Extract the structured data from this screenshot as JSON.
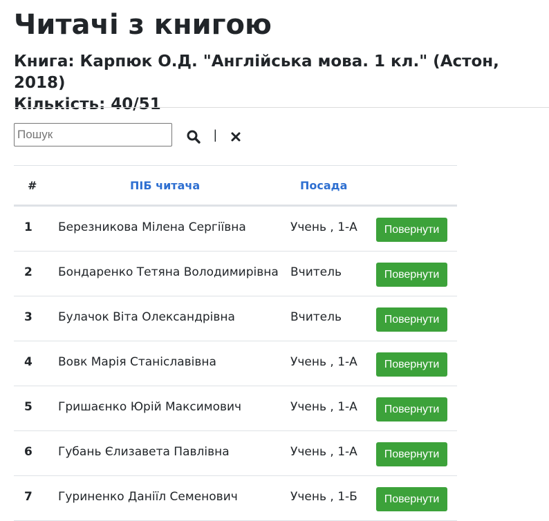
{
  "page": {
    "title": "Читачі з книгою",
    "book_line": "Книга: Карпюк О.Д. \"Англійська мова. 1 кл.\" (Астон, 2018)",
    "count_line": "Кількість: 40/51"
  },
  "search": {
    "placeholder": "Пошук",
    "value": "",
    "separator": "|",
    "search_icon": "search-icon",
    "clear_icon": "close-icon"
  },
  "table": {
    "headers": {
      "num": "#",
      "name": "ПІБ читача",
      "position": "Посада"
    },
    "rows": [
      {
        "num": "1",
        "name": "Березникова Мілена Сергіївна",
        "position": "Учень , 1-А",
        "action": "Повернути"
      },
      {
        "num": "2",
        "name": "Бондаренко Тетяна Володимирівна",
        "position": "Вчитель",
        "action": "Повернути"
      },
      {
        "num": "3",
        "name": "Булачок Віта Олександрівна",
        "position": "Вчитель",
        "action": "Повернути"
      },
      {
        "num": "4",
        "name": "Вовк Марія Станіславівна",
        "position": "Учень , 1-А",
        "action": "Повернути"
      },
      {
        "num": "5",
        "name": "Гришаєнко Юрій Максимович",
        "position": "Учень , 1-А",
        "action": "Повернути"
      },
      {
        "num": "6",
        "name": "Губань Єлизавета Павлівна",
        "position": "Учень , 1-А",
        "action": "Повернути"
      },
      {
        "num": "7",
        "name": "Гуриненко Даніїл Семенович",
        "position": "Учень , 1-Б",
        "action": "Повернути"
      }
    ]
  },
  "colors": {
    "link": "#2e6fd1",
    "button_bg": "#3ca23a",
    "text": "#212529"
  }
}
